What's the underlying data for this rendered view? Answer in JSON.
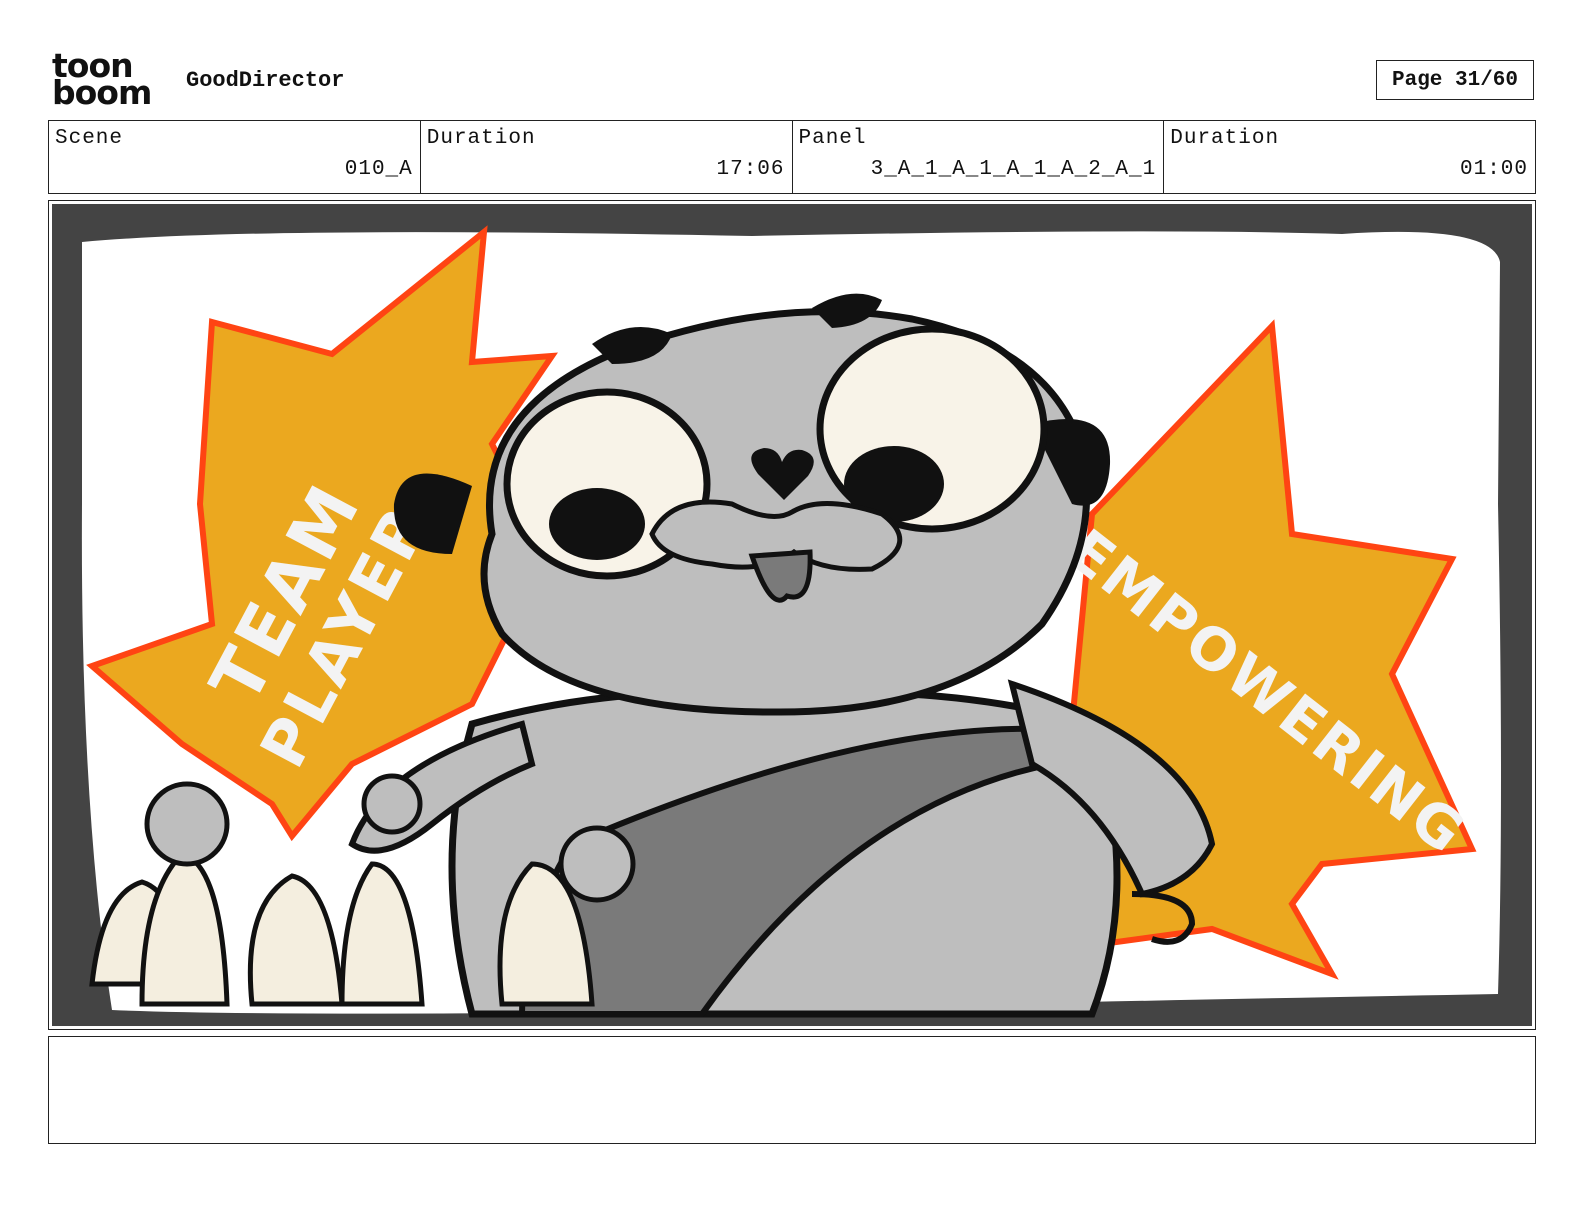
{
  "header": {
    "logo_top": "toon",
    "logo_bottom": "boom",
    "app_title": "GoodDirector",
    "page_label": "Page 31/60"
  },
  "info": [
    {
      "label": "Scene",
      "value": "010_A"
    },
    {
      "label": "Duration",
      "value": "17:06"
    },
    {
      "label": "Panel",
      "value": "3_A_1_A_1_A_1_A_2_A_1"
    },
    {
      "label": "Duration",
      "value": "01:00"
    }
  ],
  "panel": {
    "left_burst_line1": "TEAM",
    "left_burst_line2": "PLAYER",
    "right_burst": "EMPOWERING"
  },
  "notes": {
    "text": ""
  },
  "colors": {
    "burst_fill": "#EBA81F",
    "burst_outline": "#FF4413",
    "frame_dark": "#444444",
    "character_gray": "#BEBEBE",
    "sash_gray": "#7A7A7A",
    "eye_cream": "#F8F3E8"
  }
}
